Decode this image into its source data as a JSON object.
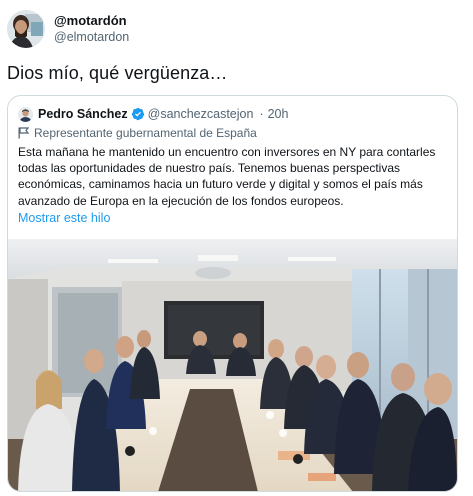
{
  "tweet": {
    "author_name": "@motardón",
    "author_handle": "@elmotardon",
    "text": "Dios mío,  qué vergüenza…"
  },
  "quoted": {
    "author_name": "Pedro Sánchez",
    "author_handle": "@sanchezcastejon",
    "separator": "·",
    "time": "20h",
    "label": "Representante gubernamental de España",
    "body": "Esta mañana he mantenido un encuentro con inversores en NY para contarles todas las oportunidades de nuestro país. Tenemos buenas perspectivas económicas, caminamos hacia un futuro verde y digital y somos el país más avanzado de Europa en la ejecución de los fondos europeos.",
    "show_thread": "Mostrar este hilo"
  },
  "colors": {
    "text": "#0f1419",
    "secondary": "#536471",
    "link": "#1d9bf0",
    "border": "#cfd9de"
  },
  "icons": [
    "avatar-image",
    "verified-badge-icon",
    "flag-icon",
    "meeting-photo"
  ]
}
